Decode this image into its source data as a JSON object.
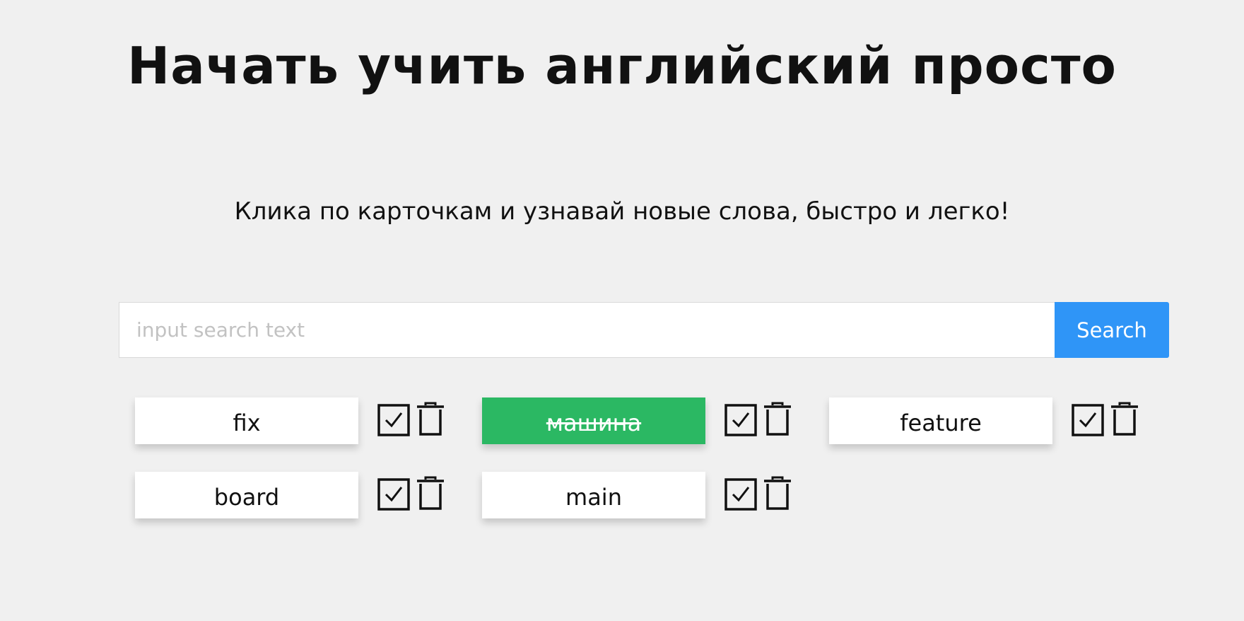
{
  "header": {
    "title": "Начать учить английский просто",
    "subtitle": "Клика по карточкам и узнавай новые слова, быстро и легко!"
  },
  "search": {
    "placeholder": "input search text",
    "value": "",
    "button_label": "Search"
  },
  "cards": [
    {
      "word": "fix",
      "learned": false
    },
    {
      "word": "машина",
      "learned": true
    },
    {
      "word": "feature",
      "learned": false
    },
    {
      "word": "board",
      "learned": false
    },
    {
      "word": "main",
      "learned": false
    }
  ],
  "icons": {
    "check": "check-square-icon",
    "delete": "trash-icon"
  },
  "colors": {
    "background": "#f0f0f0",
    "accent": "#2f95f7",
    "learned": "#2bb863",
    "card": "#ffffff"
  }
}
